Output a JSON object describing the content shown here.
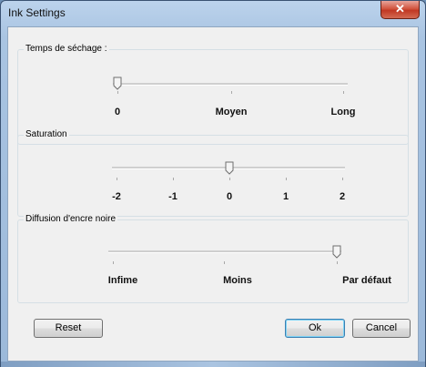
{
  "window": {
    "title": "Ink Settings",
    "close_glyph": "✕"
  },
  "drying_time": {
    "label": "Temps de séchage :",
    "value": "0",
    "labels": [
      "0",
      "Moyen",
      "Long"
    ]
  },
  "saturation": {
    "label": "Saturation",
    "value": "0",
    "labels": [
      "-2",
      "-1",
      "0",
      "1",
      "2"
    ]
  },
  "black_ink_spread": {
    "label": "Diffusion d'encre noire",
    "value": "Par défaut",
    "labels": [
      "Infime",
      "Moins",
      "Par défaut"
    ]
  },
  "buttons": {
    "reset": "Reset",
    "ok": "Ok",
    "cancel": "Cancel"
  }
}
